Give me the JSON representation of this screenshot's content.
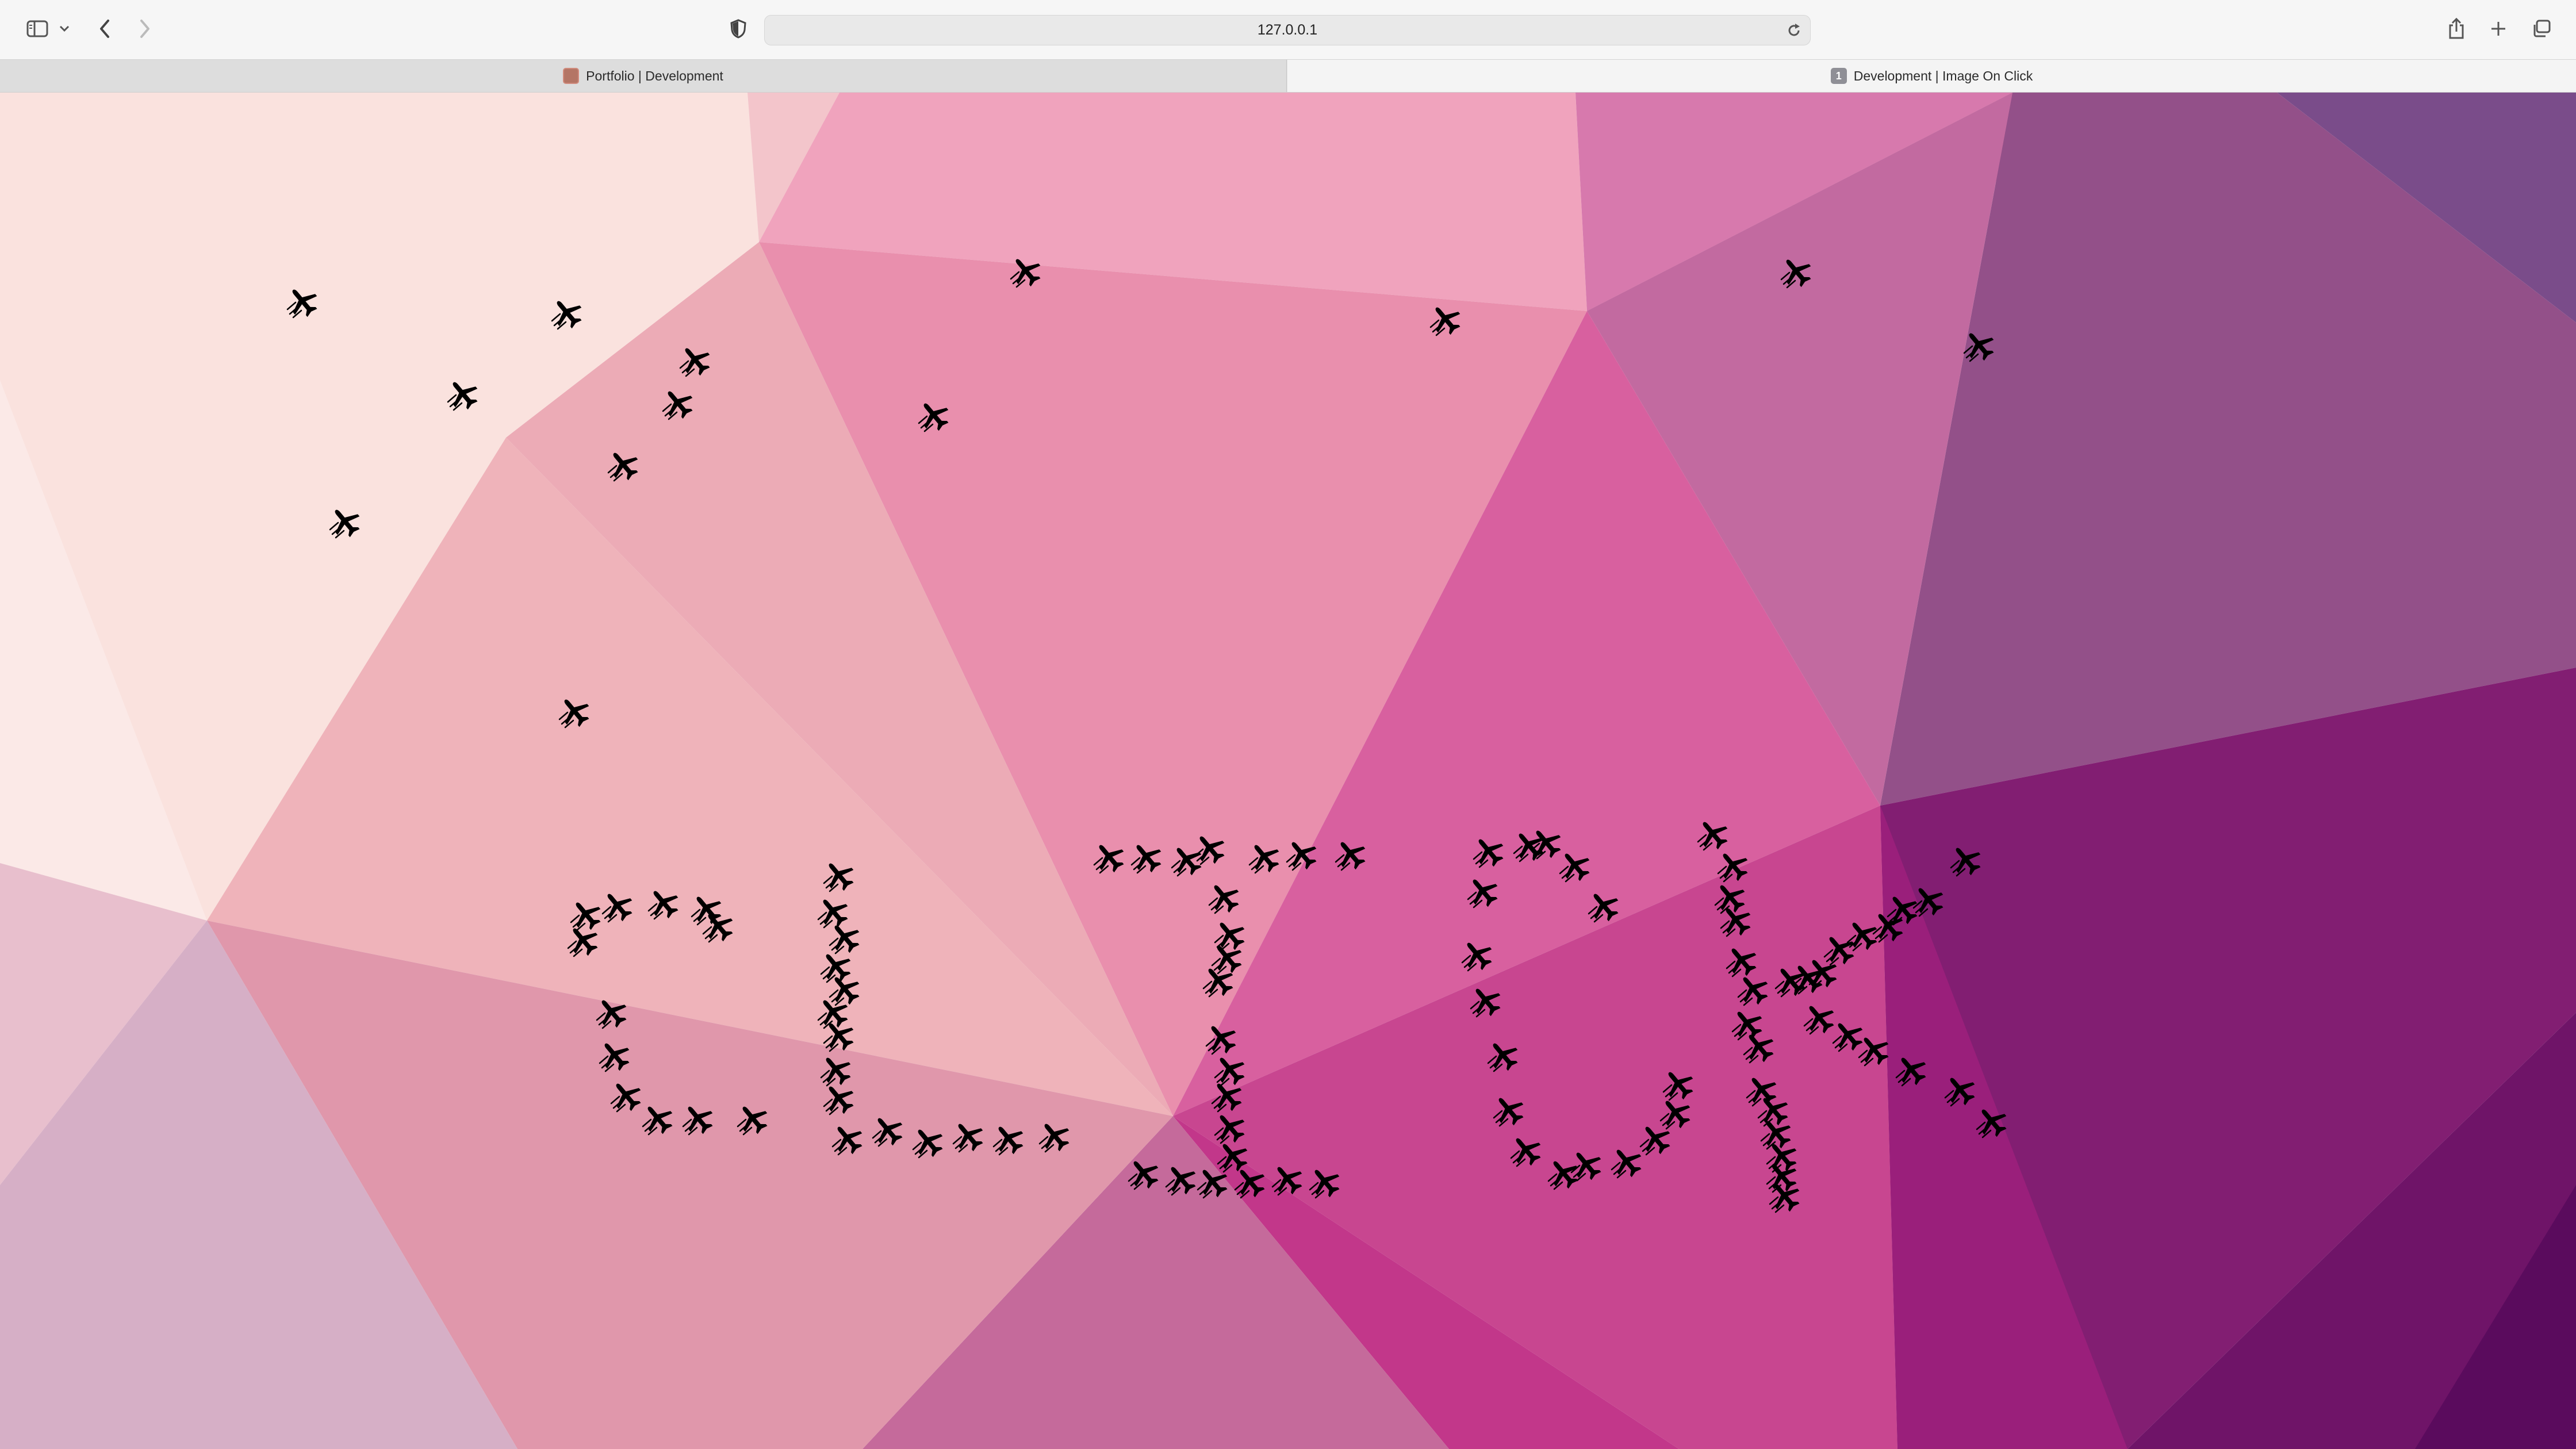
{
  "browser": {
    "address_bar": {
      "url": "127.0.0.1"
    },
    "tabs": [
      {
        "label": "Portfolio | Development",
        "active": false,
        "favicon": "portrait-favicon"
      },
      {
        "label": "Development | Image On Click",
        "active": true,
        "favicon": "number-badge-favicon",
        "badge": "1"
      }
    ],
    "icons": [
      "sidebar-icon",
      "chevron-down-icon",
      "back-arrow-icon",
      "forward-arrow-icon",
      "privacy-shield-icon",
      "reload-icon",
      "share-icon",
      "new-tab-plus-icon",
      "tab-overview-icon"
    ]
  },
  "page": {
    "background": "low-poly triangle gradient from pale pink (top-left) through magenta to deep purple (bottom-right)",
    "colors": {
      "pale": "#fae4e2",
      "pink": "#eea6bd",
      "magenta": "#c84690",
      "purple": "#84206f",
      "deep": "#5c0c5e"
    },
    "sprite": "airplane-icon",
    "drawn_word": "cLIcK"
  }
}
